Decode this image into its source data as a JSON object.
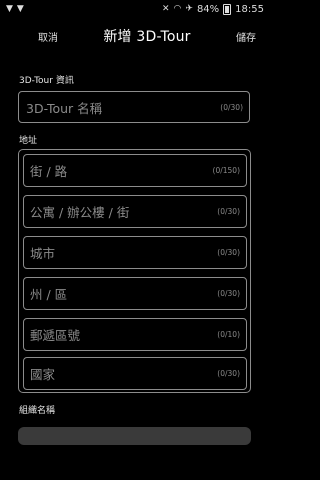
{
  "status": {
    "battery_percent": "84%",
    "time": "18:55",
    "icons_left": [
      "shield-icon",
      "shield-icon"
    ],
    "icons_right": [
      "mute-icon",
      "wifi-icon",
      "airplane-icon",
      "battery-icon"
    ]
  },
  "appbar": {
    "cancel_label": "取消",
    "title": "新增 3D-Tour",
    "save_label": "儲存"
  },
  "tour_section": {
    "label": "3D-Tour 資訊",
    "name_placeholder": "3D-Tour 名稱",
    "name_count": "(0/30)"
  },
  "address_section": {
    "label": "地址",
    "fields": [
      {
        "placeholder": "街 / 路",
        "count": "(0/150)"
      },
      {
        "placeholder": "公寓 / 辦公樓 / 街",
        "count": "(0/30)"
      },
      {
        "placeholder": "城市",
        "count": "(0/30)"
      },
      {
        "placeholder": "州 / 區",
        "count": "(0/30)"
      },
      {
        "placeholder": "郵遞區號",
        "count": "(0/10)"
      },
      {
        "placeholder": "國家",
        "count": "(0/30)"
      }
    ]
  },
  "org_section": {
    "label": "組織名稱"
  }
}
